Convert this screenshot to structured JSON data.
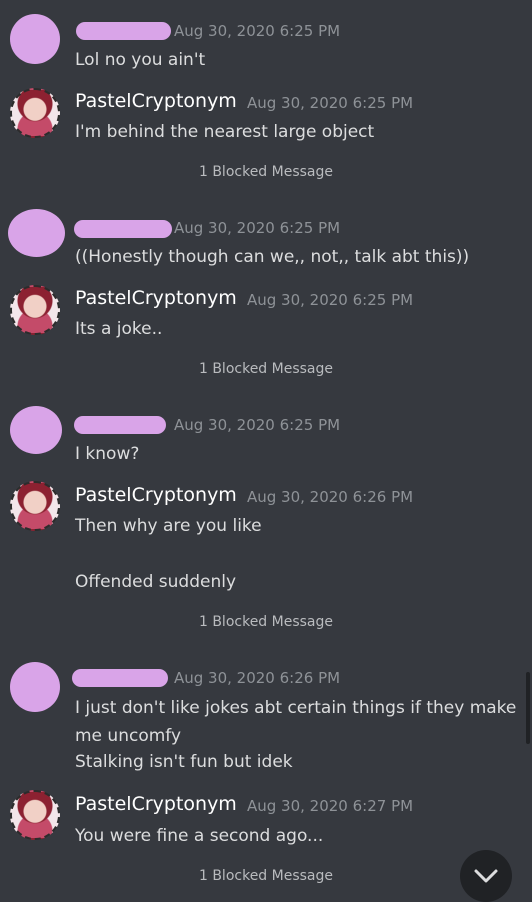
{
  "messages": [
    {
      "timestamp": "Aug 30, 2020 6:25 PM",
      "lines": [
        "Lol no you ain't"
      ]
    },
    {
      "author": "PastelCryptonym",
      "timestamp": "Aug 30, 2020 6:25 PM",
      "lines": [
        "I'm behind the nearest large object"
      ]
    },
    {
      "timestamp": "Aug 30, 2020 6:25 PM",
      "lines": [
        "((Honestly though can we,, not,, talk abt this))"
      ]
    },
    {
      "author": "PastelCryptonym",
      "timestamp": "Aug 30, 2020 6:25 PM",
      "lines": [
        "Its a joke.."
      ]
    },
    {
      "timestamp": "Aug 30, 2020 6:25 PM",
      "lines": [
        "I know?"
      ]
    },
    {
      "author": "PastelCryptonym",
      "timestamp": "Aug 30, 2020 6:26 PM",
      "lines": [
        "Then why are you like",
        "Offended suddenly"
      ]
    },
    {
      "timestamp": "Aug 30, 2020 6:26 PM",
      "lines": [
        "I just don't like jokes abt certain things if they make",
        "me uncomfy",
        "Stalking isn't fun but idek"
      ]
    },
    {
      "author": "PastelCryptonym",
      "timestamp": "Aug 30, 2020 6:27 PM",
      "lines": [
        "You were fine a second ago..."
      ]
    }
  ],
  "blocked_label": "1 Blocked Message",
  "icons": {
    "jump": "chevron-down-icon"
  },
  "colors": {
    "background": "#36393f",
    "redaction": "#d9a4e8",
    "timestamp": "#8e9297"
  }
}
